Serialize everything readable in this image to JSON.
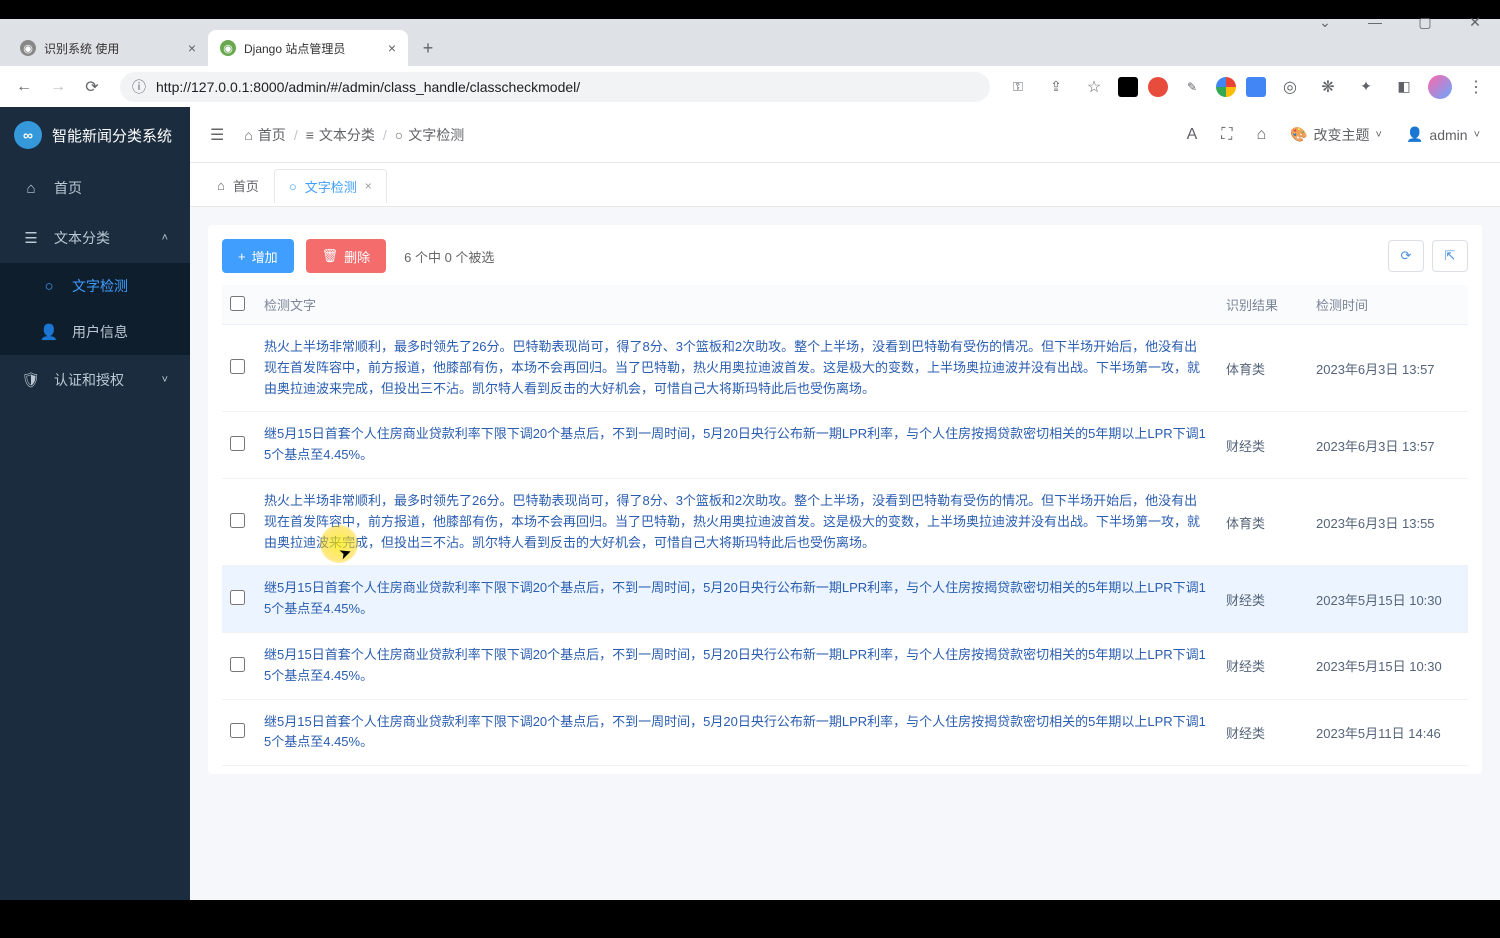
{
  "browser": {
    "tabs": [
      {
        "title": "识别系统 使用",
        "active": false
      },
      {
        "title": "Django 站点管理员",
        "active": true
      }
    ],
    "url": "http://127.0.0.1:8000/admin/#/admin/class_handle/classcheckmodel/"
  },
  "sidebar": {
    "app_name": "智能新闻分类系统",
    "items": [
      {
        "icon": "home",
        "label": "首页"
      },
      {
        "icon": "list",
        "label": "文本分类",
        "expanded": true,
        "children": [
          {
            "icon": "circle",
            "label": "文字检测",
            "active": true
          },
          {
            "icon": "user",
            "label": "用户信息"
          }
        ]
      },
      {
        "icon": "shield",
        "label": "认证和授权",
        "expanded": false
      }
    ]
  },
  "header": {
    "breadcrumb": [
      {
        "icon": "home",
        "label": "首页"
      },
      {
        "icon": "list",
        "label": "文本分类"
      },
      {
        "icon": "circle",
        "label": "文字检测"
      }
    ],
    "theme_label": "改变主题",
    "user_name": "admin"
  },
  "page_tabs": [
    {
      "icon": "home",
      "label": "首页",
      "closable": false,
      "active": false
    },
    {
      "icon": "circle",
      "label": "文字检测",
      "closable": true,
      "active": true
    }
  ],
  "toolbar": {
    "add_label": "增加",
    "delete_label": "删除",
    "selection_text": "6 个中 0 个被选"
  },
  "table": {
    "columns": {
      "text": "检测文字",
      "result": "识别结果",
      "time": "检测时间"
    },
    "rows": [
      {
        "text": "热火上半场非常顺利，最多时领先了26分。巴特勒表现尚可，得了8分、3个篮板和2次助攻。整个上半场，没看到巴特勒有受伤的情况。但下半场开始后，他没有出现在首发阵容中，前方报道，他膝部有伤，本场不会再回归。当了巴特勒，热火用奥拉迪波首发。这是极大的变数，上半场奥拉迪波并没有出战。下半场第一攻，就由奥拉迪波来完成，但投出三不沾。凯尔特人看到反击的大好机会，可惜自己大将斯玛特此后也受伤离场。",
        "result": "体育类",
        "time": "2023年6月3日 13:57"
      },
      {
        "text": "继5月15日首套个人住房商业贷款利率下限下调20个基点后，不到一周时间，5月20日央行公布新一期LPR利率，与个人住房按揭贷款密切相关的5年期以上LPR下调15个基点至4.45%。",
        "result": "财经类",
        "time": "2023年6月3日 13:57"
      },
      {
        "text": "热火上半场非常顺利，最多时领先了26分。巴特勒表现尚可，得了8分、3个篮板和2次助攻。整个上半场，没看到巴特勒有受伤的情况。但下半场开始后，他没有出现在首发阵容中，前方报道，他膝部有伤，本场不会再回归。当了巴特勒，热火用奥拉迪波首发。这是极大的变数，上半场奥拉迪波并没有出战。下半场第一攻，就由奥拉迪波来完成，但投出三不沾。凯尔特人看到反击的大好机会，可惜自己大将斯玛特此后也受伤离场。",
        "result": "体育类",
        "time": "2023年6月3日 13:55"
      },
      {
        "text": "继5月15日首套个人住房商业贷款利率下限下调20个基点后，不到一周时间，5月20日央行公布新一期LPR利率，与个人住房按揭贷款密切相关的5年期以上LPR下调15个基点至4.45%。",
        "result": "财经类",
        "time": "2023年5月15日 10:30",
        "hover": true
      },
      {
        "text": "继5月15日首套个人住房商业贷款利率下限下调20个基点后，不到一周时间，5月20日央行公布新一期LPR利率，与个人住房按揭贷款密切相关的5年期以上LPR下调15个基点至4.45%。",
        "result": "财经类",
        "time": "2023年5月15日 10:30"
      },
      {
        "text": "继5月15日首套个人住房商业贷款利率下限下调20个基点后，不到一周时间，5月20日央行公布新一期LPR利率，与个人住房按揭贷款密切相关的5年期以上LPR下调15个基点至4.45%。",
        "result": "财经类",
        "time": "2023年5月11日 14:46"
      }
    ]
  }
}
